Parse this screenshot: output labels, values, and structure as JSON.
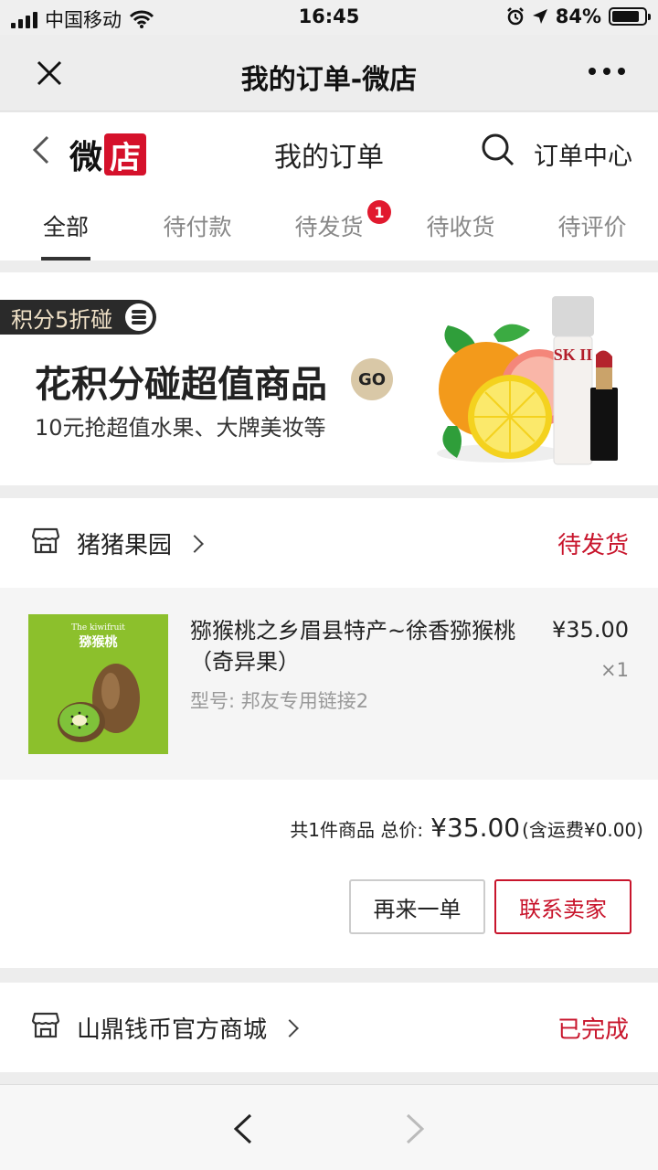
{
  "status_bar": {
    "carrier": "中国移动",
    "time": "16:45",
    "battery_text": "84%",
    "battery_level": 0.84
  },
  "wechat_nav": {
    "title": "我的订单-微店",
    "close_icon": "close-icon",
    "more_icon": "more-icon"
  },
  "store_header": {
    "logo_part1": "微",
    "logo_part2": "店",
    "title": "我的订单",
    "order_center": "订单中心",
    "accent_color": "#d5112b"
  },
  "tabs": [
    {
      "label": "全部",
      "active": true
    },
    {
      "label": "待付款"
    },
    {
      "label": "待发货",
      "badge": "1"
    },
    {
      "label": "待收货"
    },
    {
      "label": "待评价"
    }
  ],
  "banner": {
    "pill": "积分5折碰",
    "title": "花积分碰超值商品",
    "go": "GO",
    "subtitle": "10元抢超值水果、大牌美妆等",
    "product_label": "SK II"
  },
  "orders": [
    {
      "shop": "猪猪果园",
      "status": "待发货",
      "item": {
        "name": "猕猴桃之乡眉县特产~徐香猕猴桃（奇异果）",
        "spec": "型号: 邦友专用链接2",
        "price": "¥35.00",
        "qty": "×1",
        "thumb_title_en": "The kiwifruit",
        "thumb_title_cn": "猕猴桃"
      },
      "summary": {
        "count_label": "共1件商品 总价:",
        "total": "¥35.00",
        "shipping": "(含运费¥0.00)"
      },
      "buttons": {
        "again": "再来一单",
        "contact": "联系卖家"
      }
    },
    {
      "shop": "山鼎钱币官方商城",
      "status": "已完成"
    }
  ],
  "colors": {
    "status_red": "#c8152c",
    "badge_red": "#e1192e"
  }
}
